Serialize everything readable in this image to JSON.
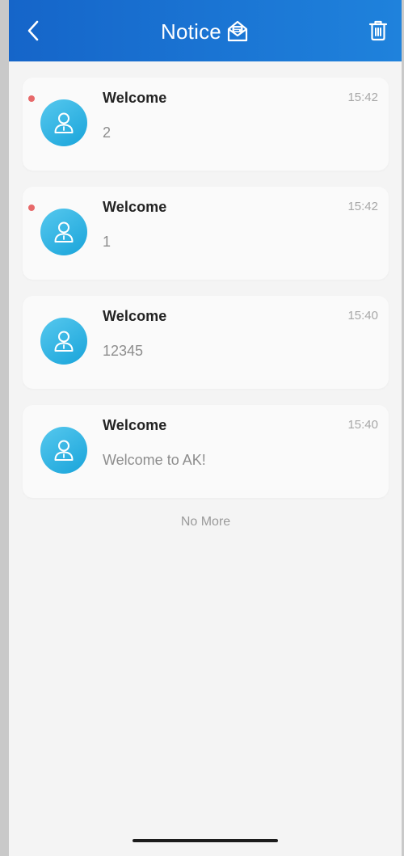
{
  "header": {
    "title": "Notice",
    "color_start": "#1565c9",
    "color_end": "#1f82dc",
    "back_icon": "chevron-left-icon",
    "title_icon": "open-envelope-icon",
    "action_icon": "trash-icon"
  },
  "notices": [
    {
      "sender": "Welcome",
      "time": "15:42",
      "body": "2",
      "unread": true
    },
    {
      "sender": "Welcome",
      "time": "15:42",
      "body": "1",
      "unread": true
    },
    {
      "sender": "Welcome",
      "time": "15:40",
      "body": "12345",
      "unread": false
    },
    {
      "sender": "Welcome",
      "time": "15:40",
      "body": "Welcome to AK!",
      "unread": false
    }
  ],
  "footer": {
    "no_more": "No More"
  },
  "colors": {
    "unread_dot": "#e7696a",
    "avatar": "#2bb3e3"
  }
}
